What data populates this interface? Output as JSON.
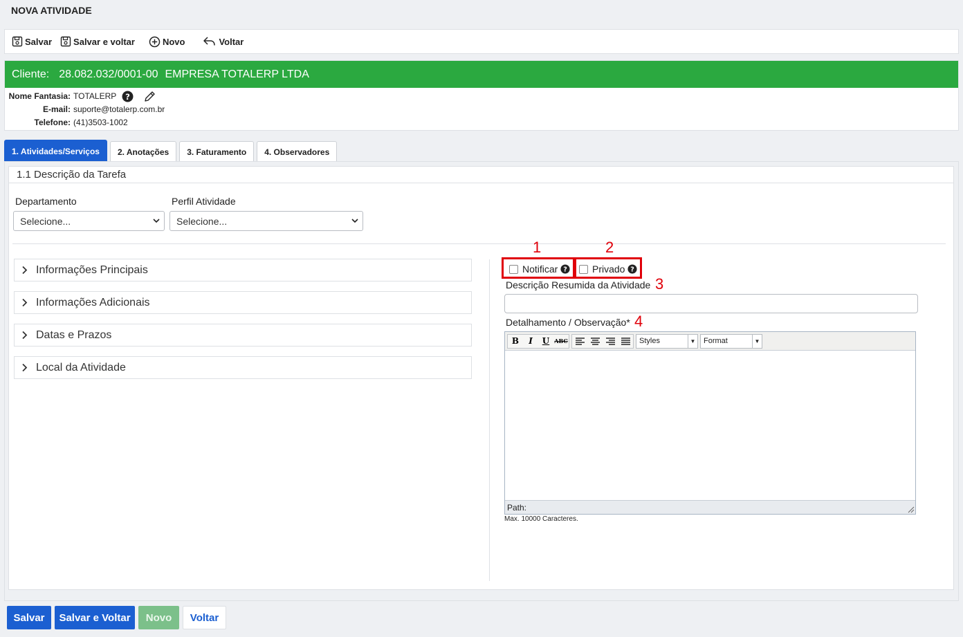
{
  "page": {
    "title": "NOVA ATIVIDADE"
  },
  "toolbar": {
    "save": "Salvar",
    "save_back": "Salvar e voltar",
    "new": "Novo",
    "back": "Voltar"
  },
  "client": {
    "label": "Cliente:",
    "cnpj": "28.082.032/0001-00",
    "name": "EMPRESA TOTALERP LTDA",
    "fantasy_label": "Nome Fantasia:",
    "fantasy_value": "TOTALERP",
    "email_label": "E-mail:",
    "email_value": "suporte@totalerp.com.br",
    "phone_label": "Telefone:",
    "phone_value": "(41)3503-1002",
    "bar_color": "#2ba940"
  },
  "tabs": [
    {
      "label": "1. Atividades/Serviços",
      "active": true
    },
    {
      "label": "2. Anotações"
    },
    {
      "label": "3. Faturamento"
    },
    {
      "label": "4. Observadores"
    }
  ],
  "section": {
    "title": "1.1 Descrição da Tarefa"
  },
  "department": {
    "label": "Departamento",
    "value": "Selecione..."
  },
  "profile": {
    "label": "Perfil Atividade",
    "value": "Selecione..."
  },
  "accordion": [
    {
      "label": "Informações Principais"
    },
    {
      "label": "Informações Adicionais"
    },
    {
      "label": "Datas e Prazos"
    },
    {
      "label": "Local da Atividade"
    }
  ],
  "annotations": {
    "n1": "1",
    "n2": "2",
    "n3": "3",
    "n4": "4"
  },
  "notify": {
    "label": "Notificar",
    "checked": false
  },
  "private": {
    "label": "Privado",
    "checked": false
  },
  "summary": {
    "label": "Descrição Resumida da Atividade",
    "value": ""
  },
  "detail": {
    "label": "Detalhamento / Observação*",
    "styles": "Styles",
    "format": "Format",
    "path": "Path:",
    "max": "Max. 10000 Caracteres."
  },
  "footer": {
    "save": "Salvar",
    "save_back": "Salvar e Voltar",
    "new": "Novo",
    "back": "Voltar"
  },
  "colors": {
    "primary": "#1b5fd1",
    "success": "#2ba940",
    "disabled_new": "#7cc08a",
    "annotation": "#e0000a"
  }
}
